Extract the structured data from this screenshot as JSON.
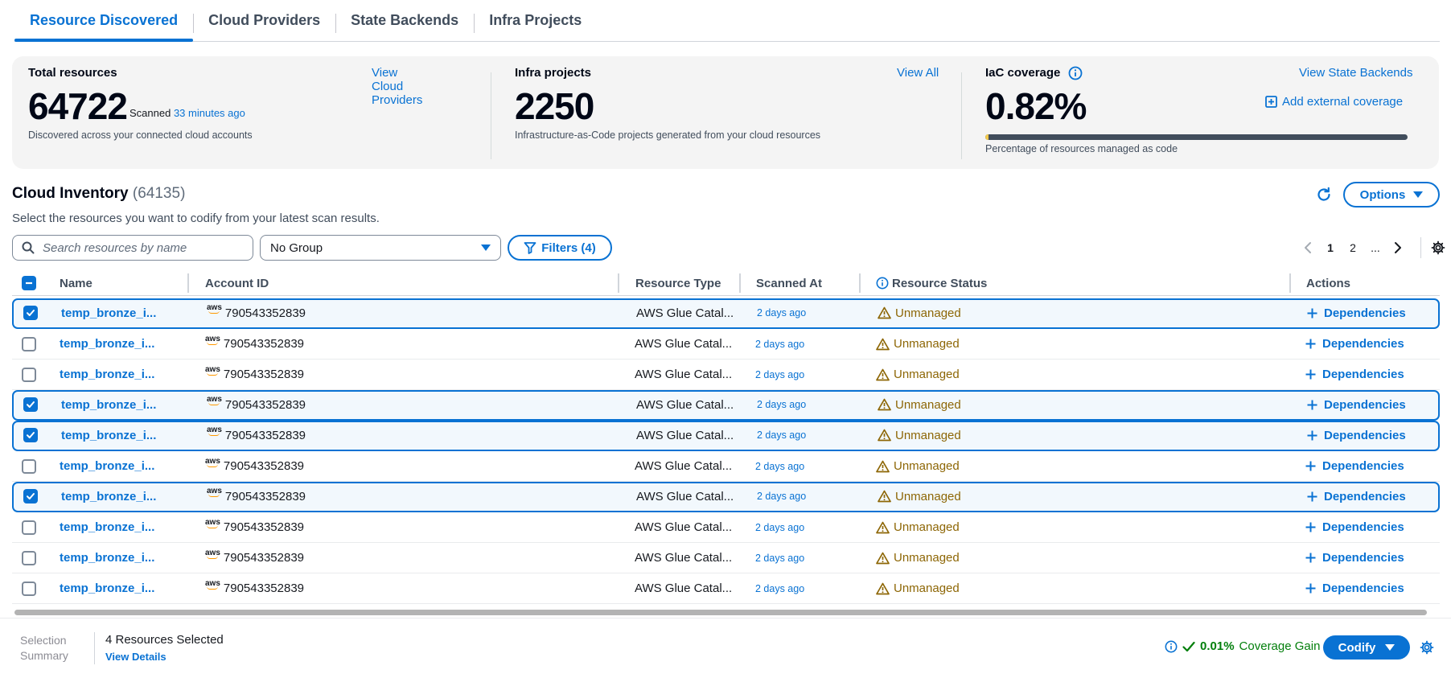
{
  "tabs": [
    {
      "label": "Resource Discovered",
      "active": true
    },
    {
      "label": "Cloud Providers",
      "active": false
    },
    {
      "label": "State Backends",
      "active": false
    },
    {
      "label": "Infra Projects",
      "active": false
    }
  ],
  "summary": {
    "total": {
      "title": "Total resources",
      "value": "64722",
      "scanned_prefix": "Scanned",
      "scanned_link": "33 minutes ago",
      "description": "Discovered across your connected cloud accounts",
      "link": "View Cloud Providers"
    },
    "infra": {
      "title": "Infra projects",
      "value": "2250",
      "description": "Infrastructure-as-Code projects generated from your cloud resources",
      "link": "View All"
    },
    "iac": {
      "title": "IaC coverage",
      "value": "0.82%",
      "coverage_fraction": 0.0082,
      "description": "Percentage of resources managed as code",
      "link": "View State Backends",
      "add_link": "Add external coverage"
    }
  },
  "inventory": {
    "title": "Cloud Inventory",
    "count": "(64135)",
    "description": "Select the resources you want to codify from your latest scan results.",
    "options_label": "Options"
  },
  "filters": {
    "search_placeholder": "Search resources by name",
    "group_value": "No Group",
    "filters_label": "Filters (4)"
  },
  "pagination": {
    "pages": [
      "1",
      "2",
      "..."
    ],
    "current": "1"
  },
  "table": {
    "columns": {
      "name": "Name",
      "account": "Account ID",
      "type": "Resource Type",
      "scanned": "Scanned At",
      "status": "Resource Status",
      "actions": "Actions"
    },
    "aws_label": "aws",
    "rows": [
      {
        "selected": true,
        "name": "temp_bronze_i...",
        "account": "790543352839",
        "type": "AWS Glue Catal...",
        "scanned": "2 days ago",
        "status": "Unmanaged",
        "action": "Dependencies"
      },
      {
        "selected": false,
        "name": "temp_bronze_i...",
        "account": "790543352839",
        "type": "AWS Glue Catal...",
        "scanned": "2 days ago",
        "status": "Unmanaged",
        "action": "Dependencies"
      },
      {
        "selected": false,
        "name": "temp_bronze_i...",
        "account": "790543352839",
        "type": "AWS Glue Catal...",
        "scanned": "2 days ago",
        "status": "Unmanaged",
        "action": "Dependencies"
      },
      {
        "selected": true,
        "name": "temp_bronze_i...",
        "account": "790543352839",
        "type": "AWS Glue Catal...",
        "scanned": "2 days ago",
        "status": "Unmanaged",
        "action": "Dependencies"
      },
      {
        "selected": true,
        "name": "temp_bronze_i...",
        "account": "790543352839",
        "type": "AWS Glue Catal...",
        "scanned": "2 days ago",
        "status": "Unmanaged",
        "action": "Dependencies"
      },
      {
        "selected": false,
        "name": "temp_bronze_i...",
        "account": "790543352839",
        "type": "AWS Glue Catal...",
        "scanned": "2 days ago",
        "status": "Unmanaged",
        "action": "Dependencies"
      },
      {
        "selected": true,
        "name": "temp_bronze_i...",
        "account": "790543352839",
        "type": "AWS Glue Catal...",
        "scanned": "2 days ago",
        "status": "Unmanaged",
        "action": "Dependencies"
      },
      {
        "selected": false,
        "name": "temp_bronze_i...",
        "account": "790543352839",
        "type": "AWS Glue Catal...",
        "scanned": "2 days ago",
        "status": "Unmanaged",
        "action": "Dependencies"
      },
      {
        "selected": false,
        "name": "temp_bronze_i...",
        "account": "790543352839",
        "type": "AWS Glue Catal...",
        "scanned": "2 days ago",
        "status": "Unmanaged",
        "action": "Dependencies"
      },
      {
        "selected": false,
        "name": "temp_bronze_i...",
        "account": "790543352839",
        "type": "AWS Glue Catal...",
        "scanned": "2 days ago",
        "status": "Unmanaged",
        "action": "Dependencies"
      }
    ]
  },
  "bottom": {
    "selection_summary": "Selection Summary",
    "resources_selected": "4 Resources Selected",
    "view_details": "View Details",
    "gain_value": "0.01%",
    "gain_label": "Coverage Gain",
    "codify_label": "Codify"
  },
  "colors": {
    "accent": "#0972d3",
    "warning": "#8d6605",
    "success": "#037f0c",
    "coverage_fill": "#f2c94c"
  }
}
